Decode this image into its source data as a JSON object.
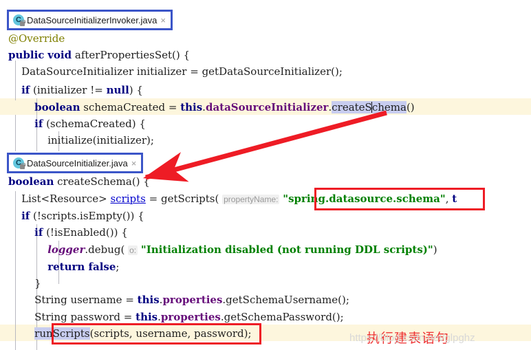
{
  "app": {
    "type": "java-ide-code-editor",
    "theme": "light"
  },
  "tabs": [
    {
      "id": "tab-datasourceinitializerinvoker",
      "label": "DataSourceInitializerInvoker.java",
      "icon": "java-class-icon",
      "close_label": "×",
      "icon_letter": "C",
      "highlight_color": "#3b55c8"
    },
    {
      "id": "tab-datasourceinitializer",
      "label": "DataSourceInitializer.java",
      "icon": "java-class-icon",
      "close_label": "×",
      "icon_letter": "C",
      "highlight_color": "#3b55c8"
    }
  ],
  "code_top": {
    "file": "DataSourceInitializerInvoker.java",
    "lines": [
      {
        "n": 1,
        "text": "@Override"
      },
      {
        "n": 2,
        "text": "public void afterPropertiesSet() {"
      },
      {
        "n": 3,
        "text": "    DataSourceInitializer initializer = getDataSourceInitializer();"
      },
      {
        "n": 4,
        "text": "    if (initializer != null) {"
      },
      {
        "n": 5,
        "text": "        boolean schemaCreated = this.dataSourceInitializer.createSchema()"
      },
      {
        "n": 6,
        "text": "        if (schemaCreated) {"
      },
      {
        "n": 7,
        "text": "            initialize(initializer);"
      }
    ],
    "selected_token": "createSchema",
    "current_line": 5
  },
  "code_bottom": {
    "file": "DataSourceInitializer.java",
    "lines": [
      {
        "n": 1,
        "text": "boolean createSchema() {"
      },
      {
        "n": 2,
        "text": "    List<Resource> scripts = getScripts( propertyName: \"spring.datasource.schema\", t"
      },
      {
        "n": 3,
        "text": "    if (!scripts.isEmpty()) {"
      },
      {
        "n": 4,
        "text": "        if (!isEnabled()) {"
      },
      {
        "n": 5,
        "text": "            logger.debug( o: \"Initialization disabled (not running DDL scripts)\")"
      },
      {
        "n": 6,
        "text": "            return false;"
      },
      {
        "n": 7,
        "text": "        }"
      },
      {
        "n": 8,
        "text": "        String username = this.properties.getSchemaUsername();"
      },
      {
        "n": 9,
        "text": "        String password = this.properties.getSchemaPassword();"
      },
      {
        "n": 10,
        "text": "        runScripts(scripts, username, password);"
      }
    ],
    "selected_token": "runScripts",
    "current_line": 10,
    "param_hints": [
      "propertyName:",
      "o:"
    ],
    "strings": [
      "\"spring.datasource.schema\"",
      "\"Initialization disabled (not running DDL scripts)\""
    ]
  },
  "annotations": {
    "chinese_note": "执行建表语句",
    "note_color": "#ee3333",
    "box_color": "#ee1c25",
    "arrow_color": "#ee1c25",
    "boxes": [
      {
        "id": "box-schema-property",
        "target": "\"spring.datasource.schema\""
      },
      {
        "id": "box-runscripts",
        "target": "runScripts(scripts, username, password);"
      }
    ],
    "arrow": {
      "id": "arrow-createschema",
      "from": "createSchema() call site",
      "to": "createSchema() declaration"
    }
  },
  "watermark": {
    "text": "https://blog.csdn.net/glpghz",
    "color": "#d8d8d8"
  },
  "colors": {
    "keyword": "#000080",
    "annotation": "#808000",
    "field": "#660e7a",
    "string": "#008000",
    "link": "#0000cc",
    "selection": "#c8cdf0",
    "current_line": "#fdf6dd",
    "tab_border": "#3b55c8",
    "box": "#ee1c25"
  }
}
